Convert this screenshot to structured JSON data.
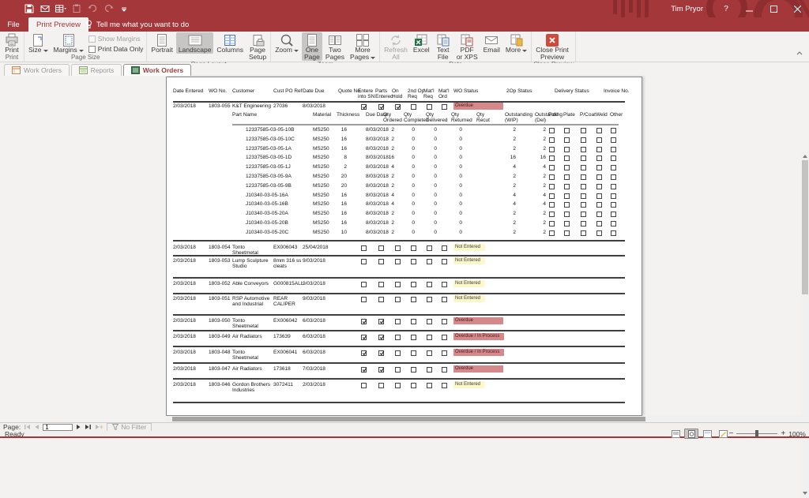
{
  "titlebar": {
    "user": "Tim Pryor",
    "help": "?",
    "qat_icons": [
      "save-icon",
      "email-save-icon",
      "datasheet-icon",
      "paste-icon",
      "undo-icon",
      "redo-icon",
      "customize-qat-icon"
    ]
  },
  "menu": {
    "file": "File",
    "active_tab": "Print Preview",
    "tell_me": "Tell me what you want to do"
  },
  "ribbon": {
    "groups": [
      {
        "label": "Print",
        "buttons": [
          {
            "icon": "printer",
            "lines": [
              "Print"
            ],
            "caret": false
          }
        ]
      },
      {
        "label": "Page Size",
        "buttons": [
          {
            "icon": "size",
            "lines": [
              "Size"
            ],
            "caret": true
          },
          {
            "icon": "margins",
            "lines": [
              "Margins"
            ],
            "caret": true
          }
        ],
        "checks": [
          {
            "label": "Show Margins",
            "checked": false,
            "disabled": true
          },
          {
            "label": "Print Data Only",
            "checked": false,
            "disabled": false
          }
        ]
      },
      {
        "label": "Page Layout",
        "buttons": [
          {
            "icon": "portrait",
            "lines": [
              "Portrait"
            ]
          },
          {
            "icon": "landscape",
            "lines": [
              "Landscape"
            ],
            "selected": true
          },
          {
            "icon": "columns",
            "lines": [
              "Columns"
            ]
          },
          {
            "icon": "pagesetup",
            "lines": [
              "Page",
              "Setup"
            ]
          }
        ]
      },
      {
        "label": "Zoom",
        "buttons": [
          {
            "icon": "zoom",
            "lines": [
              "Zoom"
            ],
            "caret": true
          },
          {
            "icon": "onepage",
            "lines": [
              "One",
              "Page"
            ],
            "selected": true
          },
          {
            "icon": "twopages",
            "lines": [
              "Two",
              "Pages"
            ]
          },
          {
            "icon": "morepages",
            "lines": [
              "More",
              "Pages"
            ],
            "caret": true
          }
        ]
      },
      {
        "label": "Data",
        "buttons": [
          {
            "icon": "refresh",
            "lines": [
              "Refresh",
              "All"
            ],
            "disabled": true
          },
          {
            "icon": "excel",
            "lines": [
              "Excel"
            ]
          },
          {
            "icon": "textfile",
            "lines": [
              "Text",
              "File"
            ]
          },
          {
            "icon": "pdf",
            "lines": [
              "PDF",
              "or XPS"
            ]
          },
          {
            "icon": "email",
            "lines": [
              "Email"
            ]
          },
          {
            "icon": "moreexport",
            "lines": [
              "More"
            ],
            "caret": true
          }
        ]
      },
      {
        "label": "Close Preview",
        "buttons": [
          {
            "icon": "closepreview",
            "lines": [
              "Close Print",
              "Preview"
            ]
          }
        ]
      }
    ]
  },
  "doc_tabs": [
    {
      "label": "Work Orders",
      "icon": "form-icon",
      "active": false
    },
    {
      "label": "Reports",
      "icon": "report-icon",
      "active": false
    },
    {
      "label": "Work Orders",
      "icon": "report-green-icon",
      "active": true
    }
  ],
  "report": {
    "header": {
      "date_entered": "Date Entered",
      "wo_no": "WO No.",
      "customer": "Customer",
      "po": "Cust PO Ref",
      "date_due": "Date Due",
      "quote_no": "Quote No.",
      "checks": [
        [
          "Entere",
          "into SN"
        ],
        [
          "Parts",
          "Entered"
        ],
        [
          "On",
          "Hold"
        ],
        [
          "2nd Op",
          "Req"
        ],
        [
          "Mat'l",
          "Req"
        ],
        [
          "Mat'l",
          "Ord"
        ]
      ],
      "wo_status": "WO Status",
      "op2_status": "2Op Status",
      "delivery_status": "Delivery Status",
      "invoice_no": "Invoice No."
    },
    "part_header": {
      "part_name": "Part Name",
      "material": "Material",
      "thickness": "Thickness",
      "due_date": "Due Date",
      "qty_cols": [
        [
          "Qty",
          "Ordered"
        ],
        [
          "Qty",
          "Completed"
        ],
        [
          "Qty",
          "Delivered"
        ],
        [
          "Qty",
          "Returned"
        ],
        [
          "Qty",
          "Recut"
        ],
        [
          "Outstanding",
          "(WIP)"
        ],
        [
          "Outstanding",
          "(Del)"
        ]
      ],
      "op_cols": [
        "Fold",
        "Plate",
        "P/Coat",
        "Weld",
        "Other"
      ]
    },
    "groups": [
      {
        "date": "2/03/2018",
        "wo": "1803-055",
        "customer": "K&T Engineering",
        "po": "27036",
        "due": "8/03/2018",
        "quote": "",
        "checks": [
          1,
          1,
          1,
          0,
          0,
          0
        ],
        "status": "Overdue",
        "status_type": "overdue",
        "parts": [
          [
            "12337585-03-05-10B",
            "MS250",
            "16",
            "8/03/2018",
            "2",
            "0",
            "0",
            "0",
            "",
            "2",
            "2"
          ],
          [
            "12337585-03-05-10C",
            "MS250",
            "16",
            "8/03/2018",
            "2",
            "0",
            "0",
            "0",
            "",
            "2",
            "2"
          ],
          [
            "12337585-03-05-1A",
            "MS250",
            "16",
            "8/03/2018",
            "2",
            "0",
            "0",
            "0",
            "",
            "2",
            "2"
          ],
          [
            "12337585-03-05-1D",
            "MS250",
            "8",
            "8/03/2018",
            "16",
            "0",
            "0",
            "0",
            "",
            "16",
            "16"
          ],
          [
            "12337585-03-05-1J",
            "MS250",
            "2",
            "8/03/2018",
            "4",
            "0",
            "0",
            "0",
            "",
            "4",
            "4"
          ],
          [
            "12337585-03-05-9A",
            "MS250",
            "20",
            "8/03/2018",
            "2",
            "0",
            "0",
            "0",
            "",
            "2",
            "2"
          ],
          [
            "12337585-03-05-9B",
            "MS250",
            "20",
            "8/03/2018",
            "2",
            "0",
            "0",
            "0",
            "",
            "2",
            "2"
          ],
          [
            "J10340-03-05-16A",
            "MS250",
            "16",
            "8/03/2018",
            "4",
            "0",
            "0",
            "0",
            "",
            "4",
            "4"
          ],
          [
            "J10340-03-05-16B",
            "MS250",
            "16",
            "8/03/2018",
            "4",
            "0",
            "0",
            "0",
            "",
            "4",
            "4"
          ],
          [
            "J10340-03-05-20A",
            "MS250",
            "16",
            "8/03/2018",
            "2",
            "0",
            "0",
            "0",
            "",
            "2",
            "2"
          ],
          [
            "J10340-03-05-20B",
            "MS250",
            "16",
            "8/03/2018",
            "2",
            "0",
            "0",
            "0",
            "",
            "2",
            "2"
          ],
          [
            "J10340-03-05-20C",
            "MS250",
            "10",
            "8/03/2018",
            "2",
            "0",
            "0",
            "0",
            "",
            "2",
            "2"
          ]
        ]
      },
      {
        "date": "2/03/2018",
        "wo": "1803-054",
        "customer": "Tonto Sheetmetal",
        "po": "EX006043",
        "due": "25/04/2018",
        "quote": "",
        "checks": [
          0,
          0,
          0,
          0,
          0,
          0
        ],
        "status": "Not Entered",
        "status_type": "notentered",
        "parts": []
      },
      {
        "date": "2/03/2018",
        "wo": "1803-053",
        "customer": "Lump Sculpture Studio",
        "po": "8mm 316 ss cleats",
        "due": "9/03/2018",
        "quote": "",
        "checks": [
          0,
          0,
          0,
          0,
          0,
          0
        ],
        "status": "Not Entered",
        "status_type": "notentered",
        "parts": []
      },
      {
        "date": "2/03/2018",
        "wo": "1803-052",
        "customer": "Able Conveyors",
        "po": "G000815ALL",
        "due": "9/03/2018",
        "quote": "",
        "checks": [
          0,
          0,
          0,
          0,
          0,
          0
        ],
        "status": "Not Entered",
        "status_type": "notentered",
        "parts": []
      },
      {
        "date": "2/03/2018",
        "wo": "1803-051",
        "customer": "RSP Automotive and Industrial",
        "po": "REAR CALIPER",
        "due": "9/03/2018",
        "quote": "",
        "checks": [
          0,
          0,
          0,
          0,
          0,
          0
        ],
        "status": "Not Entered",
        "status_type": "notentered",
        "parts": []
      },
      {
        "date": "2/03/2018",
        "wo": "1803-050",
        "customer": "Tonto Sheetmetal",
        "po": "EX006042",
        "due": "6/03/2018",
        "quote": "",
        "checks": [
          1,
          1,
          0,
          0,
          0,
          0
        ],
        "status": "Overdue",
        "status_type": "overdue",
        "parts": []
      },
      {
        "date": "2/03/2018",
        "wo": "1803-049",
        "customer": "Air Radiators",
        "po": "173639",
        "due": "6/03/2018",
        "quote": "",
        "checks": [
          1,
          1,
          0,
          0,
          0,
          0
        ],
        "status": "Overdue / In Process",
        "status_type": "inprocess",
        "parts": []
      },
      {
        "date": "2/03/2018",
        "wo": "1803-048",
        "customer": "Tonto Sheetmetal",
        "po": "EX006041",
        "due": "6/03/2018",
        "quote": "",
        "checks": [
          1,
          1,
          0,
          0,
          0,
          0
        ],
        "status": "Overdue / In Process",
        "status_type": "inprocess",
        "parts": []
      },
      {
        "date": "2/03/2018",
        "wo": "1803-047",
        "customer": "Air Radiators",
        "po": "173618",
        "due": "7/03/2018",
        "quote": "",
        "checks": [
          1,
          1,
          0,
          0,
          0,
          0
        ],
        "status": "Overdue",
        "status_type": "overdue",
        "parts": []
      },
      {
        "date": "2/03/2018",
        "wo": "1803-046",
        "customer": "Gordon Brothers Industries",
        "po": "3072411",
        "due": "2/03/2018",
        "quote": "",
        "checks": [
          0,
          0,
          0,
          0,
          0,
          0
        ],
        "status": "Not Entered",
        "status_type": "notentered",
        "parts": []
      }
    ]
  },
  "nav": {
    "page_label": "Page:",
    "page_value": "1",
    "no_filter": "No Filter"
  },
  "status": {
    "ready": "Ready",
    "zoom_pct": "100%"
  },
  "colors": {
    "accent": "#a4373a",
    "overdue_bg": "#d6898b",
    "not_entered_bg": "#fbf8cd"
  }
}
